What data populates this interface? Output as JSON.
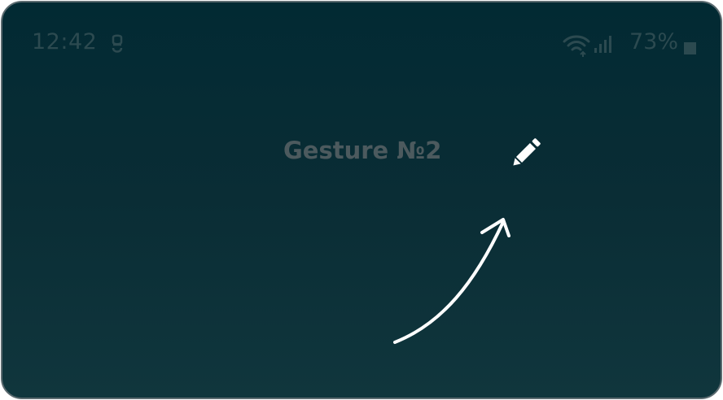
{
  "status_bar": {
    "time": "12:42",
    "battery_percent": "73%",
    "icons": [
      "sync-icon",
      "wifi-icon",
      "signal-icon",
      "battery-icon"
    ]
  },
  "main": {
    "title": "Gesture №2",
    "edit_icon": "pencil-icon",
    "gesture_indicator": "arrow-up-right-icon"
  },
  "colors": {
    "background_top": "#022a33",
    "background_bottom": "#10363d",
    "status_text": "#2c4a50",
    "title_text": "#4c5a5e",
    "icon_white": "#ffffff"
  }
}
